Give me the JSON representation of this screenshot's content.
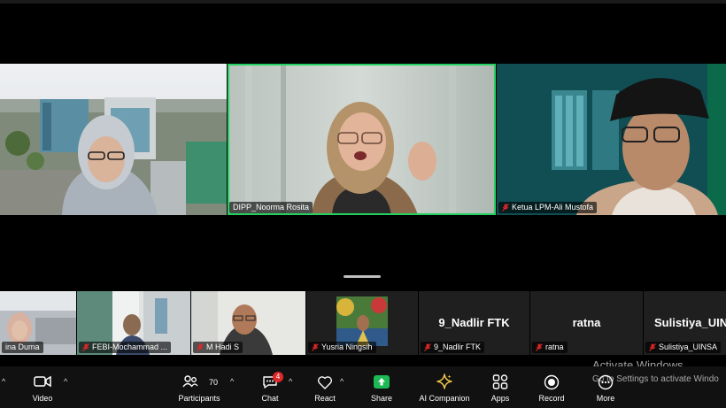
{
  "gallery": {
    "main_tiles": [
      {
        "name": ""
      },
      {
        "name": "DIPP_Noorma Rosita"
      },
      {
        "name": "Ketua LPM-Ali Mustofa"
      }
    ],
    "strip_tiles": [
      {
        "name": "ina Duma"
      },
      {
        "name": "FEBI-Mochammad ..."
      },
      {
        "name": "M Hadi S"
      },
      {
        "name": "Yusria Ningsih"
      },
      {
        "name": "9_Nadlir FTK",
        "display_name": "9_Nadlir FTK"
      },
      {
        "name": "ratna",
        "display_name": "ratna"
      },
      {
        "name": "Sulistiya_UINSA",
        "display_name": "Sulistiya_UIN"
      }
    ]
  },
  "toolbar": {
    "video_label": "Video",
    "participants_label": "Participants",
    "participants_count": "70",
    "chat_label": "Chat",
    "chat_badge": "4",
    "react_label": "React",
    "share_label": "Share",
    "ai_label": "AI Companion",
    "apps_label": "Apps",
    "record_label": "Record",
    "more_label": "More"
  },
  "watermark": {
    "title": "Activate Windows",
    "subtitle": "Go to Settings to activate Windo"
  },
  "colors": {
    "active_speaker": "#23d160",
    "share_green": "#1db954",
    "badge_red": "#e02828",
    "toolbar_bg": "#111111"
  }
}
